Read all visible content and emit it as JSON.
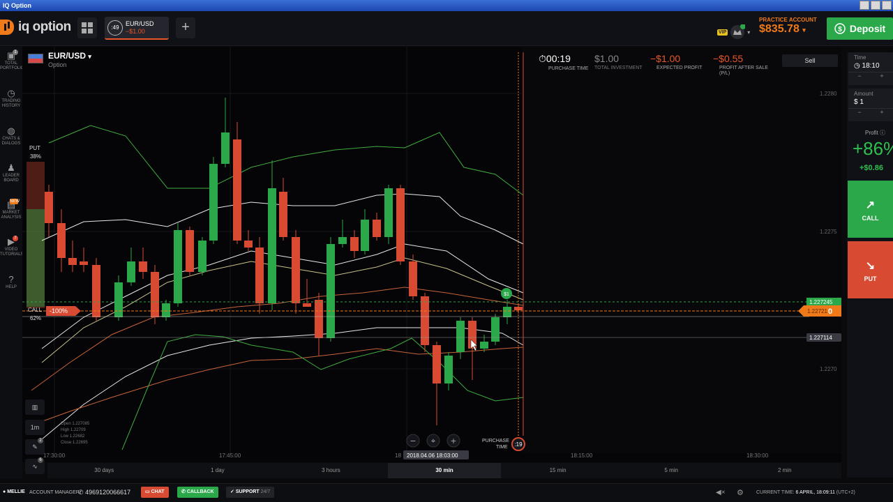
{
  "window": {
    "title": "IQ Option"
  },
  "topbar": {
    "logo_text": "iq option",
    "asset_tab": {
      "timer": ":49",
      "name": "EUR/USD",
      "amount": "−$1.00"
    },
    "add_tab": "+",
    "vip_badge": "VIP",
    "practice_label": "PRACTICE ACCOUNT",
    "balance": "$835.78",
    "deposit": "Deposit"
  },
  "leftnav": [
    {
      "icon": "portfolio-icon",
      "glyph": "▣",
      "label": "TOTAL PORTFOLIO",
      "badge": "1"
    },
    {
      "icon": "history-icon",
      "glyph": "◷",
      "label": "TRADING HISTORY",
      "badge": ""
    },
    {
      "icon": "chat-icon",
      "glyph": "◍",
      "label": "CHATS & DIALOGS",
      "badge": ""
    },
    {
      "icon": "leaderboard-icon",
      "glyph": "♟",
      "label": "LEADER BOARD",
      "badge": ""
    },
    {
      "icon": "market-analysis-icon",
      "glyph": "▤",
      "label": "MARKET ANALYSIS",
      "badge": "NEW"
    },
    {
      "icon": "video-icon",
      "glyph": "▶",
      "label": "VIDEO TUTORIALS",
      "badge": "7"
    },
    {
      "icon": "help-icon",
      "glyph": "?",
      "label": "HELP",
      "badge": ""
    }
  ],
  "asset": {
    "name": "EUR/USD",
    "type": "Option"
  },
  "deal": {
    "purchase_time": "00:19",
    "purchase_time_label": "PURCHASE TIME",
    "total_investment": "$1.00",
    "total_investment_label": "TOTAL INVESTMENT",
    "expected_profit": "−$1.00",
    "expected_profit_label": "EXPECTED PROFIT",
    "profit_after_sale": "−$0.55",
    "profit_after_sale_label": "PROFIT AFTER SALE (P/L)",
    "sell": "Sell"
  },
  "sentiment": {
    "put_label": "PUT",
    "put_pct": "38%",
    "call_label": "CALL",
    "call_pct": "62%"
  },
  "trade_marker": {
    "value": "-100%",
    "bubble": "$1"
  },
  "price_labels": {
    "p1": "1.2280",
    "p2": "1.2275",
    "p3": "1.2270",
    "current": "1.227245",
    "bid": "1.22721",
    "bid_suffix": "0",
    "line": "1.227114"
  },
  "time_axis": [
    "17:30:00",
    "17:45:00",
    "18",
    "18:15:00",
    "18:30:00"
  ],
  "time_cursor": "2018.04.06 18:03:00",
  "ohlc": {
    "open": "Open  1.227085",
    "high": "High   1.22709",
    "low": "Low    1.22682",
    "close": "Close  1.22695"
  },
  "purchase_marker": {
    "label1": "PURCHASE",
    "label2": "TIME",
    "timer": ":19"
  },
  "zoom": {
    "minus": "−",
    "center": "⌖",
    "plus": "+"
  },
  "chart_tools": {
    "interval": "1m",
    "draw_badge": "2",
    "indicators_badge": "6"
  },
  "right_panel": {
    "time_label": "Time",
    "time_value": "18:10",
    "amount_label": "Amount",
    "amount_value": "$ 1",
    "profit_label": "Profit",
    "profit_pct": "+86%",
    "profit_amt": "+$0.86",
    "call": "CALL",
    "put": "PUT"
  },
  "timeframes": [
    "30 days",
    "1 day",
    "3 hours",
    "30 min",
    "15 min",
    "5 min",
    "2 min"
  ],
  "status": {
    "user": "MELLIE",
    "account_manager": "ACCOUNT MANAGER",
    "phone": "4969120066617",
    "chat": "CHAT",
    "callback": "CALLBACK",
    "support": "SUPPORT",
    "support_hours": "24/7",
    "current_time_label": "CURRENT TIME:",
    "current_time": "6 APRIL, 18:09:11",
    "tz": "(UTC+2)"
  },
  "colors": {
    "green": "#2aa84a",
    "red": "#d84a32",
    "orange": "#f07a1a"
  }
}
